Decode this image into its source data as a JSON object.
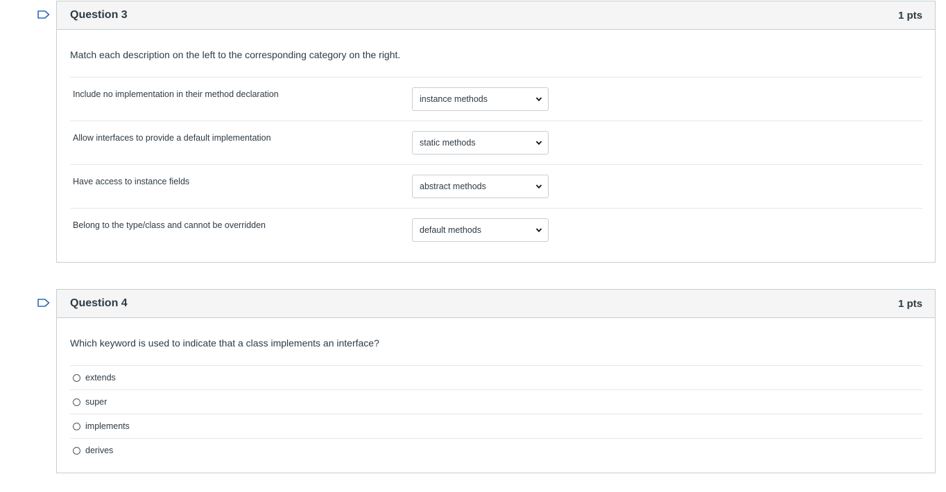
{
  "questions": [
    {
      "title": "Question 3",
      "points": "1 pts",
      "prompt": "Match each description on the left to the corresponding category on the right.",
      "matches": [
        {
          "description": "Include no implementation in their method declaration",
          "selected": "instance methods"
        },
        {
          "description": "Allow interfaces to provide a default implementation",
          "selected": "static methods"
        },
        {
          "description": "Have access to instance fields",
          "selected": "abstract methods"
        },
        {
          "description": "Belong to the type/class and cannot be overridden",
          "selected": "default methods"
        }
      ]
    },
    {
      "title": "Question 4",
      "points": "1 pts",
      "prompt": "Which keyword is used to indicate that a class implements an interface?",
      "answers": [
        "extends",
        "super",
        "implements",
        "derives"
      ]
    }
  ],
  "icons": {
    "flag": "bookmark-flag-icon",
    "dropdown": "chevron-down-icon",
    "radio": "radio-unselected"
  },
  "colors": {
    "flag_stroke": "#2d6ab4",
    "border": "#c7cdd1",
    "header_bg": "#f5f5f5",
    "text": "#2d3b45"
  }
}
